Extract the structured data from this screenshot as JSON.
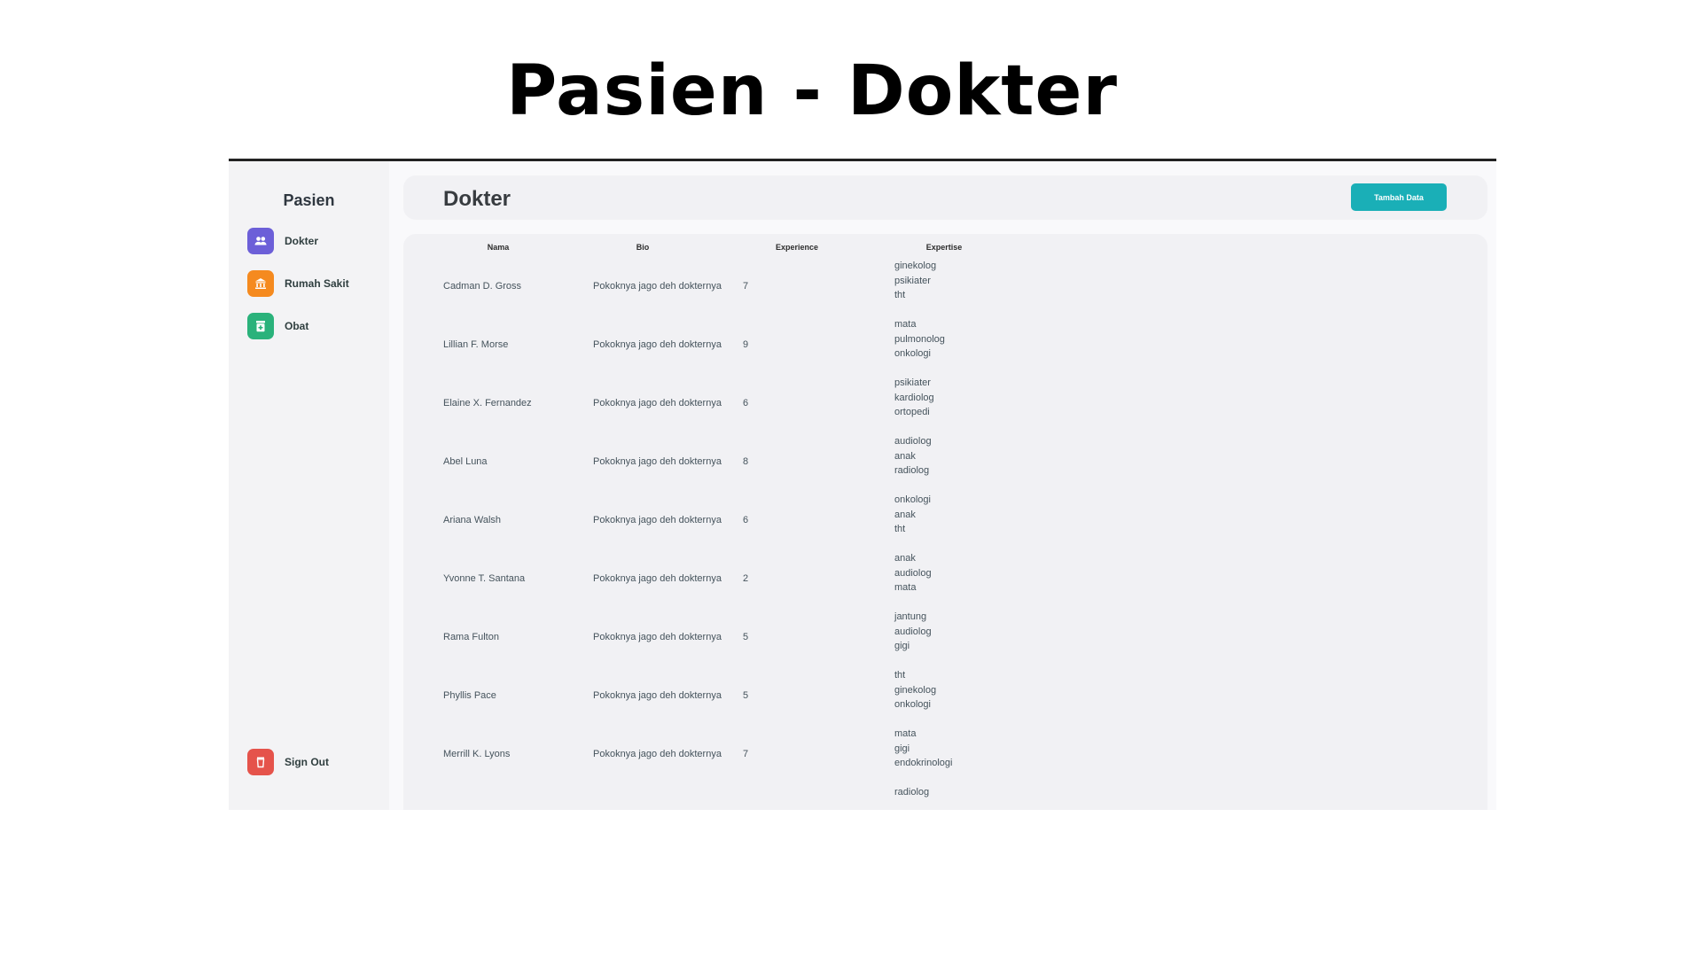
{
  "slide_title": "Pasien - Dokter",
  "sidebar": {
    "title": "Pasien",
    "items": [
      {
        "label": "Dokter",
        "icon": "users-icon",
        "color": "#6c5fd8"
      },
      {
        "label": "Rumah Sakit",
        "icon": "hospital-icon",
        "color": "#f58a1f"
      },
      {
        "label": "Obat",
        "icon": "medicine-icon",
        "color": "#2ab27b"
      }
    ],
    "sign_out": {
      "label": "Sign Out",
      "icon": "trash-icon",
      "color": "#e5534b"
    }
  },
  "header": {
    "title": "Dokter",
    "add_button": "Tambah Data"
  },
  "table": {
    "columns": [
      "Nama",
      "Bio",
      "Experience",
      "Expertise"
    ],
    "rows": [
      {
        "name": "Cadman D. Gross",
        "bio": "Pokoknya jago deh dokternya",
        "experience": "7",
        "expertise": [
          "ginekolog",
          "psikiater",
          "tht"
        ]
      },
      {
        "name": "Lillian F. Morse",
        "bio": "Pokoknya jago deh dokternya",
        "experience": "9",
        "expertise": [
          "mata",
          "pulmonolog",
          "onkologi"
        ]
      },
      {
        "name": "Elaine X. Fernandez",
        "bio": "Pokoknya jago deh dokternya",
        "experience": "6",
        "expertise": [
          "psikiater",
          "kardiolog",
          "ortopedi"
        ]
      },
      {
        "name": "Abel Luna",
        "bio": "Pokoknya jago deh dokternya",
        "experience": "8",
        "expertise": [
          "audiolog",
          "anak",
          "radiolog"
        ]
      },
      {
        "name": "Ariana Walsh",
        "bio": "Pokoknya jago deh dokternya",
        "experience": "6",
        "expertise": [
          "onkologi",
          "anak",
          "tht"
        ]
      },
      {
        "name": "Yvonne T. Santana",
        "bio": "Pokoknya jago deh dokternya",
        "experience": "2",
        "expertise": [
          "anak",
          "audiolog",
          "mata"
        ]
      },
      {
        "name": "Rama Fulton",
        "bio": "Pokoknya jago deh dokternya",
        "experience": "5",
        "expertise": [
          "jantung",
          "audiolog",
          "gigi"
        ]
      },
      {
        "name": "Phyllis Pace",
        "bio": "Pokoknya jago deh dokternya",
        "experience": "5",
        "expertise": [
          "tht",
          "ginekolog",
          "onkologi"
        ]
      },
      {
        "name": "Merrill K. Lyons",
        "bio": "Pokoknya jago deh dokternya",
        "experience": "7",
        "expertise": [
          "mata",
          "gigi",
          "endokrinologi"
        ]
      },
      {
        "name": "",
        "bio": "",
        "experience": "",
        "expertise": [
          "radiolog"
        ]
      }
    ]
  }
}
